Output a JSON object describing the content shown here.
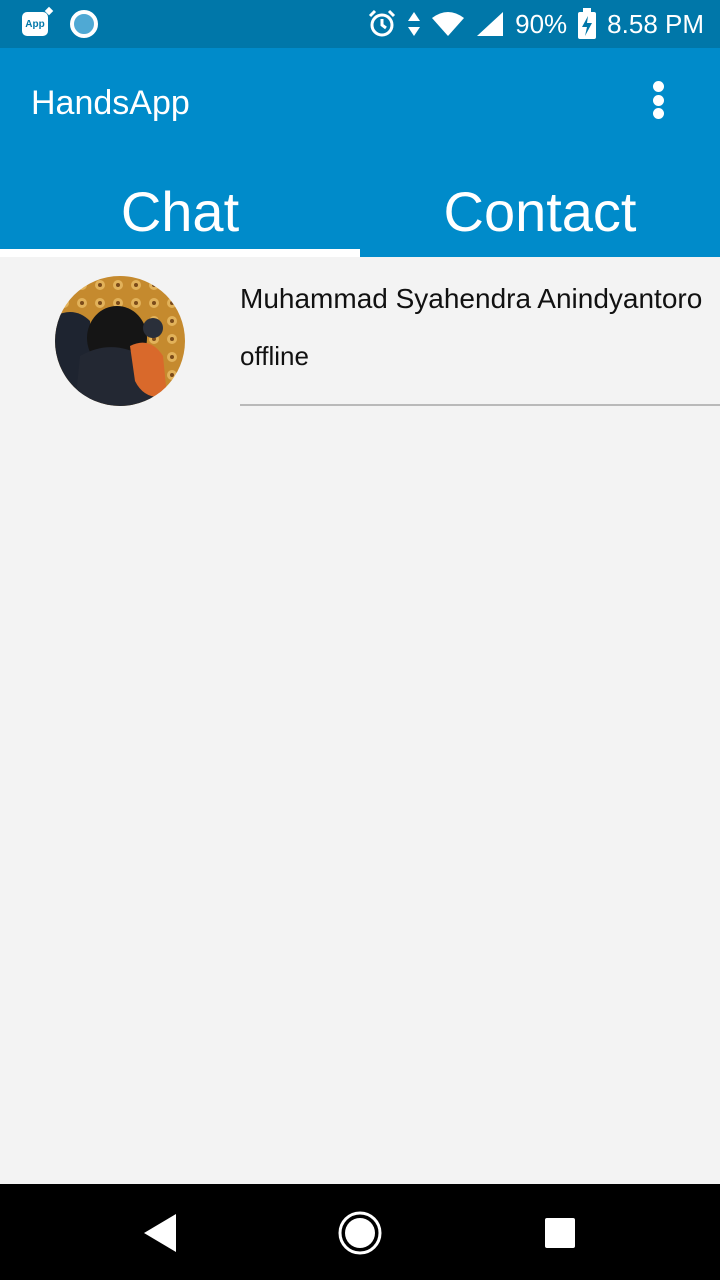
{
  "status_bar": {
    "app_notification_label": "App",
    "battery": "90%",
    "time": "8.58 PM"
  },
  "app_bar": {
    "title": "HandsApp"
  },
  "tabs": [
    {
      "label": "Chat",
      "active": true
    },
    {
      "label": "Contact",
      "active": false
    }
  ],
  "chats": [
    {
      "name": "Muhammad Syahendra Anindyantoro",
      "status": "offline"
    }
  ],
  "colors": {
    "status_bar": "#0077a9",
    "app_bar": "#008bca",
    "background": "#f3f3f3",
    "nav_bar": "#000000"
  },
  "icons": {
    "status_left": [
      "app-notification-icon",
      "circle-notification-icon"
    ],
    "status_right": [
      "alarm-icon",
      "data-arrows-icon",
      "wifi-icon",
      "signal-icon",
      "battery-charging-icon"
    ],
    "app_bar": "overflow-menu-icon",
    "nav": [
      "back-icon",
      "home-icon",
      "recents-icon"
    ]
  }
}
